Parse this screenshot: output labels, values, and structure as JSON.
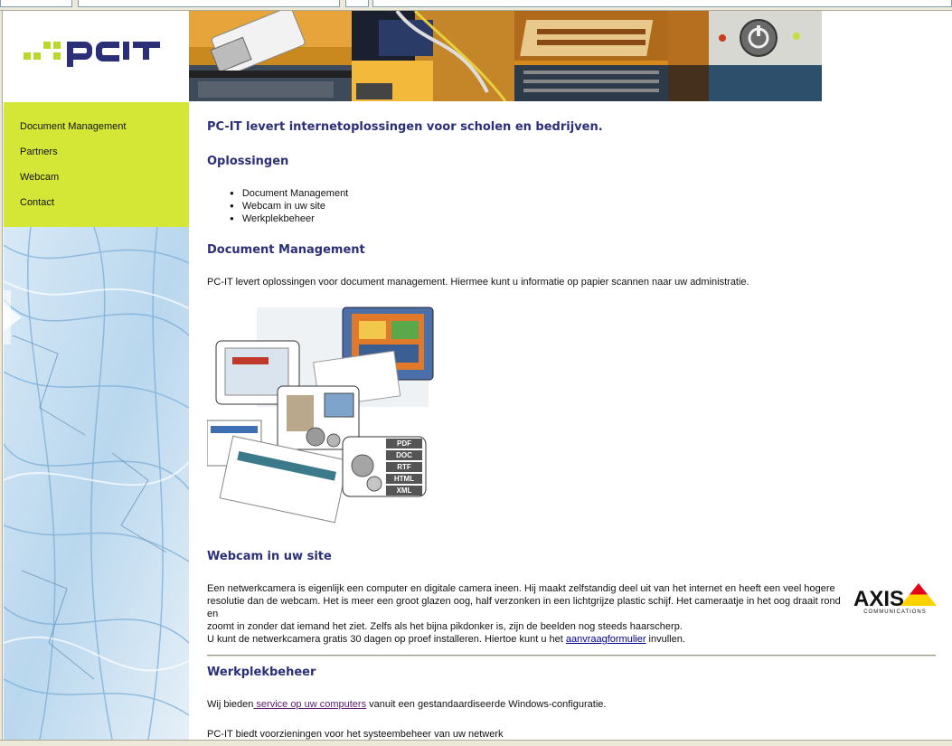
{
  "logo": {
    "text": "PCIT"
  },
  "nav": {
    "items": [
      {
        "label": "Document Management"
      },
      {
        "label": "Partners"
      },
      {
        "label": "Webcam"
      },
      {
        "label": "Contact"
      }
    ]
  },
  "main": {
    "intro_heading": "PC-IT levert  internetoplossingen voor scholen en bedrijven.",
    "solutions": {
      "heading": "Oplossingen",
      "items": [
        "Document Management",
        "Webcam in uw site",
        "Werkplekbeheer"
      ]
    },
    "document_management": {
      "heading": "Document Management",
      "text": "PC-IT levert oplossingen voor document management.  Hiermee kunt u informatie op papier scannen naar uw administratie.",
      "illustration_labels": [
        "PDF",
        "DOC",
        "RTF",
        "HTML",
        "XML"
      ]
    },
    "webcam": {
      "heading": "Webcam in uw site",
      "line1": "Een netwerkcamera is eigenlijk een computer en digitale camera ineen. Hij maakt zelfstandig deel uit van het internet en heeft een veel hogere",
      "line2": "resolutie dan de webcam. Het is meer een groot glazen oog, half verzonken in een lichtgrijze plastic schijf. Het cameraatje in het oog draait rond en",
      "line3": "zoomt in zonder dat iemand het ziet. Zelfs als het bijna pikdonker is, zijn de beelden nog steeds haarscherp.",
      "line4_pre": "U kunt de netwerkcamera gratis 30 dagen op proef installeren. Hiertoe kunt u het ",
      "line4_link": "aanvraagformulier",
      "line4_post": " invullen.",
      "axis_logo_text": "AXIS",
      "axis_logo_sub": "COMMUNICATIONS"
    },
    "werkplek": {
      "heading": "Werkplekbeheer",
      "line1_pre": "Wij bieden",
      "line1_link": " service op uw computers",
      "line1_post": " vanuit een gestandaardiseerde Windows-configuratie.",
      "line2": "PC-IT biedt voorzieningen voor het systeembeheer van uw netwerk"
    }
  },
  "colors": {
    "nav_bg": "#d4e737",
    "heading": "#2b2f78",
    "logo_green": "#b8d82a"
  }
}
